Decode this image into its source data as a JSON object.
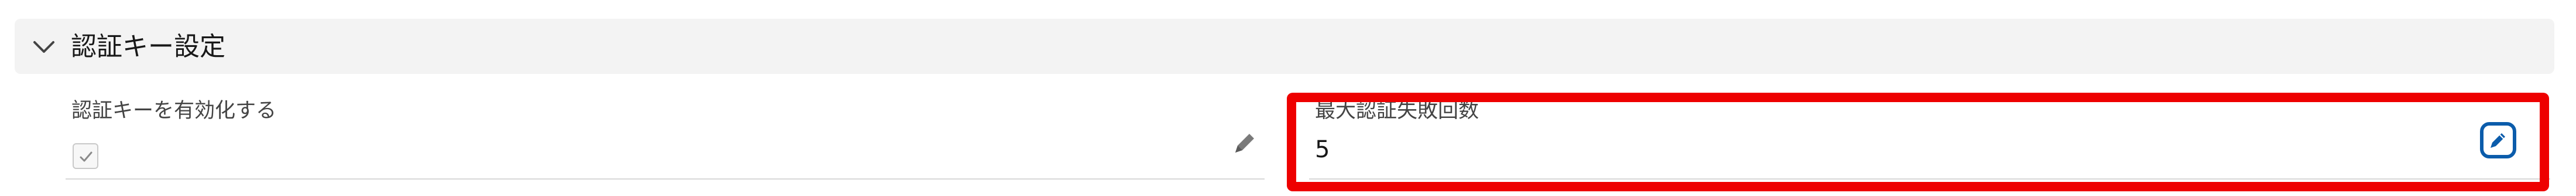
{
  "section": {
    "title": "認証キー設定",
    "chevron_icon": "chevron-down-icon"
  },
  "fields": {
    "enable_auth_key": {
      "label": "認証キーを有効化する",
      "checked": true,
      "edit_icon": "pencil-icon"
    },
    "max_auth_failures": {
      "label": "最大認証失敗回数",
      "value": "5",
      "edit_icon": "pencil-icon"
    }
  },
  "colors": {
    "highlight": "#ee0000",
    "edit_accent": "#0b5cab",
    "header_bg": "#f3f3f3"
  }
}
